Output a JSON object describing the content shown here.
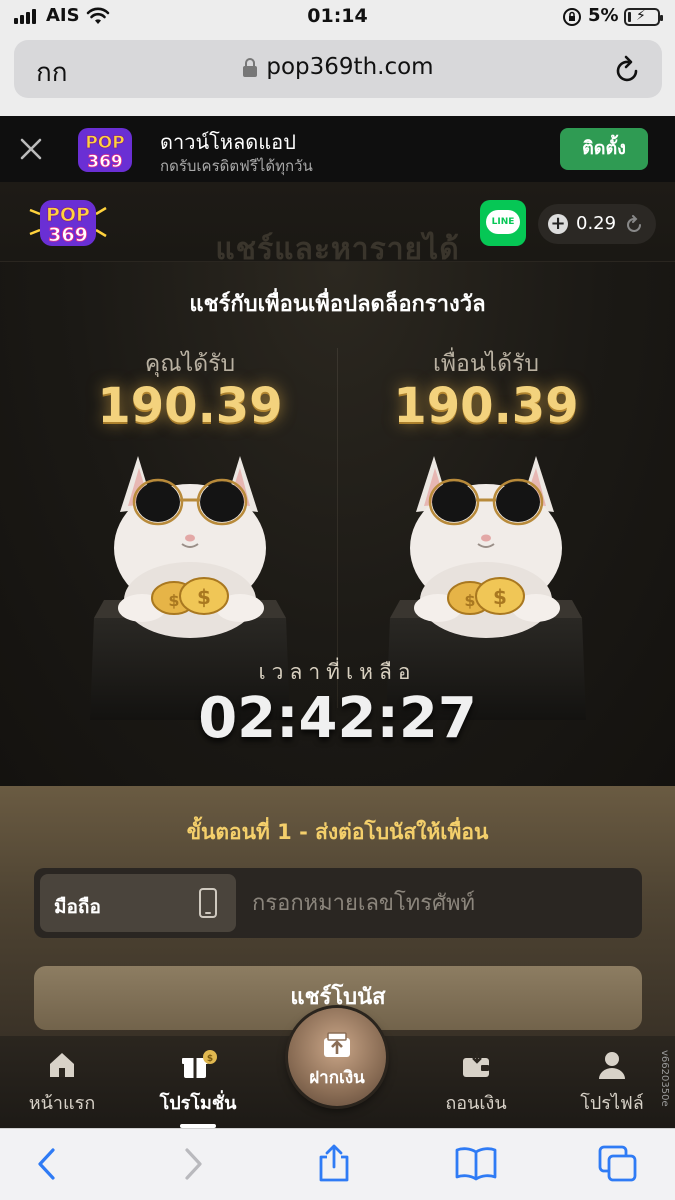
{
  "status_bar": {
    "carrier": "AIS",
    "time": "01:14",
    "battery_percent": "5%",
    "icons": [
      "signal-icon",
      "wifi-icon",
      "orientation-lock-icon",
      "battery-charging-icon"
    ]
  },
  "safari": {
    "aa_label": "กก",
    "url": "pop369th.com",
    "icons": [
      "lock-icon",
      "reload-icon",
      "back-icon",
      "forward-icon",
      "share-icon",
      "bookmarks-icon",
      "tabs-icon"
    ]
  },
  "app_banner": {
    "logo_text": "POP 369",
    "title": "ดาวน์โหลดแอป",
    "subtitle": "กดรับเครดิตฟรีได้ทุกวัน",
    "install_label": "ติดตั้ง"
  },
  "header": {
    "logo_text": "POP 369",
    "background_title": "แชร์และหารายได้",
    "line_label": "LINE",
    "balance": "0.29"
  },
  "share": {
    "title": "แชร์กับเพื่อนเพื่อปลดล็อกรางวัล",
    "you_label": "คุณได้รับ",
    "you_amount": "190.39",
    "friend_label": "เพื่อนได้รับ",
    "friend_amount": "190.39",
    "timer_label": "เวลาที่เหลือ",
    "timer_value": "02:42:27"
  },
  "step": {
    "title": "ขั้นตอนที่ 1 - ส่งต่อโบนัสให้เพื่อน",
    "phone_type_label": "มือถือ",
    "phone_placeholder": "กรอกหมายเลขโทรศัพท์",
    "share_button_label": "แชร์โบนัส"
  },
  "bottom_nav": {
    "home": "หน้าแรก",
    "promotions": "โปรโมชั่น",
    "deposit": "ฝากเงิน",
    "withdraw": "ถอนเงิน",
    "profile": "โปรไฟล์",
    "active": "promotions"
  },
  "version": "v6620350e",
  "colors": {
    "gold": "#f3d27d",
    "install_green": "#2f9b53",
    "line_green": "#06c755",
    "step_title": "#f4cf6b"
  }
}
